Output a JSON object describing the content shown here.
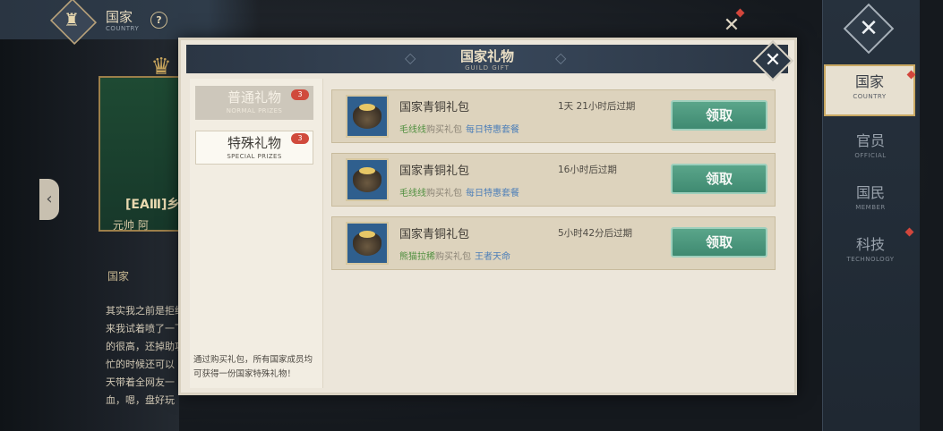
{
  "topbar": {
    "title": "国家",
    "subtitle": "COUNTRY",
    "help": "?"
  },
  "background": {
    "player_name": "[EAⅢ]乡",
    "player_role": "元帅  阿",
    "section_title": "国家",
    "description_lines": [
      "其实我之前是拒绝",
      "来我试着喷了一下",
      "的很高，还掉助攻",
      "忙的时候还可以",
      "天带着全网友一",
      "血，嗯，盘好玩"
    ]
  },
  "modal": {
    "title": "国家礼物",
    "subtitle": "GUILD GIFT",
    "tabs": [
      {
        "label": "普通礼物",
        "sublabel": "NORMAL PRIZES",
        "badge": "3"
      },
      {
        "label": "特殊礼物",
        "sublabel": "SPECIAL PRIZES",
        "badge": "3"
      }
    ],
    "note": "通过购买礼包，所有国家成员均可获得一份国家特殊礼物！",
    "gifts": [
      {
        "name": "国家青铜礼包",
        "expire": "1天 21小时后过期",
        "buyer": "毛线线",
        "action": "购买礼包",
        "package": "每日特惠套餐",
        "button": "领取"
      },
      {
        "name": "国家青铜礼包",
        "expire": "16小时后过期",
        "buyer": "毛线线",
        "action": "购买礼包",
        "package": "每日特惠套餐",
        "button": "领取"
      },
      {
        "name": "国家青铜礼包",
        "expire": "5小时42分后过期",
        "buyer": "熊猫拉稀",
        "action": "购买礼包",
        "package": "王者天命",
        "button": "领取"
      }
    ]
  },
  "rightnav": [
    {
      "label": "国家",
      "sublabel": "COUNTRY",
      "active": true
    },
    {
      "label": "官员",
      "sublabel": "OFFICIAL",
      "active": false
    },
    {
      "label": "国民",
      "sublabel": "MEMBER",
      "active": false
    },
    {
      "label": "科技",
      "sublabel": "TECHNOLOGY",
      "active": false
    }
  ],
  "icons": {
    "close": "close-icon",
    "help": "help-icon",
    "arrow": "chevron-left-icon",
    "gift": "gift-bag-icon"
  },
  "colors": {
    "claim_button": "#4a9a7e",
    "badge": "#d04a3c",
    "buyer_green": "#4f8f3f",
    "package_blue": "#4d7fb8",
    "header_navy": "#2f3c4a"
  }
}
